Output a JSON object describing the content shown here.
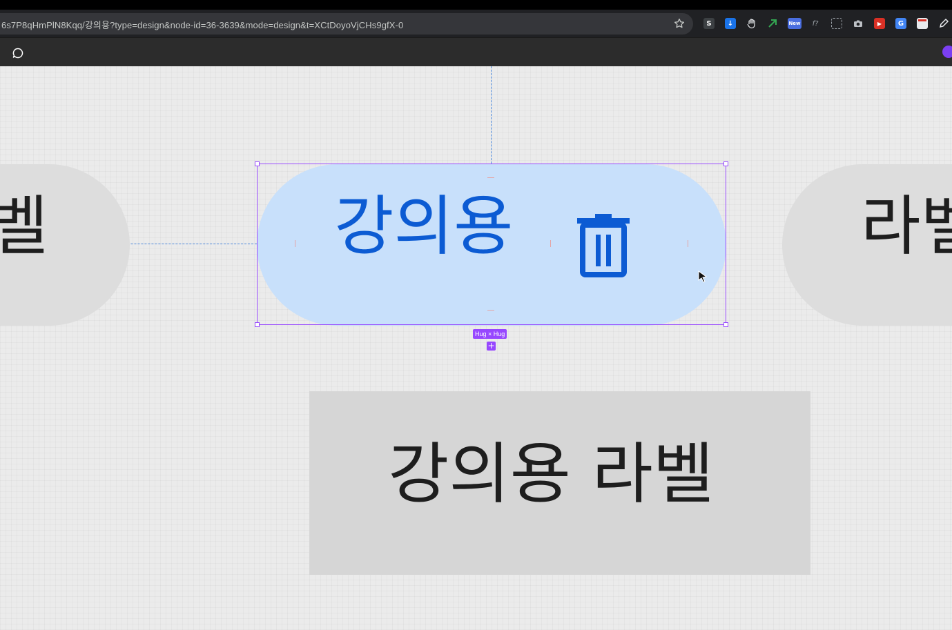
{
  "browser": {
    "url": "6s7P8qHmPlN8Kqq/강의용?type=design&node-id=36-3639&mode=design&t=XCtDoyoVjCHs9gfX-0",
    "extensions": [
      {
        "name": "s-extension-icon",
        "label": "S",
        "color": "#3c4043"
      },
      {
        "name": "download-icon",
        "label": "↓",
        "color": "#1a73e8"
      },
      {
        "name": "hand-icon",
        "label": "✋",
        "color": "#202124"
      },
      {
        "name": "bird-icon",
        "label": "✈",
        "color": "#202124"
      },
      {
        "name": "new-badge-extension-icon",
        "label": "New",
        "color": "#4a6ee0"
      },
      {
        "name": "function-icon",
        "label": "f?",
        "color": "#202124"
      },
      {
        "name": "screen-capture-icon",
        "label": "⛶",
        "color": "#202124"
      },
      {
        "name": "camera-icon",
        "label": "◉",
        "color": "#202124"
      },
      {
        "name": "youtube-icon",
        "label": "▶",
        "color": "#d93025"
      },
      {
        "name": "translate-icon",
        "label": "G",
        "color": "#4285f4"
      },
      {
        "name": "calendar-icon",
        "label": "▭",
        "color": "#e8eaed"
      },
      {
        "name": "pen-icon",
        "label": "✎",
        "color": "#202124"
      }
    ]
  },
  "canvas": {
    "left_pill_text": "벨",
    "right_pill_text": "라벨",
    "selected_pill_text": "강의용",
    "selection_size_label": "Hug × Hug",
    "add_label": "+",
    "bottom_rect_text": "강의용 라벨"
  },
  "colors": {
    "selection": "#9747ff",
    "selected_text": "#0c5bd3",
    "selected_fill": "#c8e0fb",
    "guide": "#4f8de3"
  }
}
